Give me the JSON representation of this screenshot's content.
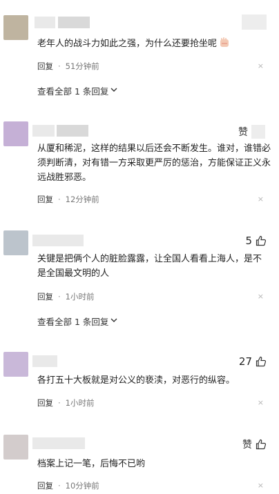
{
  "comments": [
    {
      "text": "老年人的战斗力如此之强，为什么还要抢坐呢",
      "emoji_icon": "hand-wave-emoji",
      "reply_label": "回复",
      "time": "51分钟前",
      "close_icon": "×",
      "view_all": "查看全部 1 条回复",
      "avatar_color": "#bfb4a0"
    },
    {
      "text": "从厦和稀泥，这样的结果以后还会不断发生。谁对，谁错必须判断清，对有错一方采取更严厉的惩治，方能保证正义永远战胜邪恶。",
      "like_label": "赞",
      "reply_label": "回复",
      "time": "12分钟前",
      "close_icon": "×",
      "avatar_color": "#c5b0d6"
    },
    {
      "text": "关键是把俩个人的脏脸露露，让全国人看看上海人，是不是全国最文明的人",
      "like_count": "5",
      "reply_label": "回复",
      "time": "1小时前",
      "close_icon": "×",
      "view_all": "查看全部 1 条回复",
      "avatar_color": "#bcc4cc"
    },
    {
      "text": "各打五十大板就是对公义的亵渎，对恶行的纵容。",
      "like_count": "27",
      "reply_label": "回复",
      "time": "1小时前",
      "close_icon": "×",
      "avatar_color": "#c9b8d9"
    },
    {
      "text": "档案上记一笔，后悔不已哟",
      "like_label": "赞",
      "reply_label": "回复",
      "time": "10分钟前",
      "close_icon": "×",
      "avatar_color": "#d3cccc"
    }
  ],
  "icons": {
    "like": "thumbs-up-icon",
    "view_all_chevron": "chevron-down-icon",
    "close": "close-icon"
  }
}
